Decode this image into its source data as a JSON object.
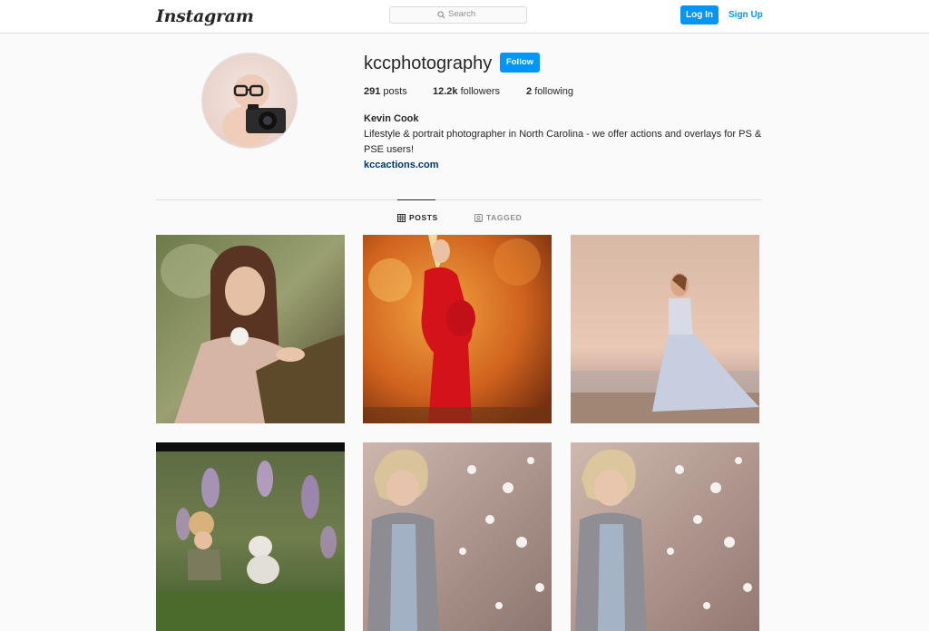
{
  "header": {
    "logo_text": "Instagram",
    "search_placeholder": "Search",
    "login_label": "Log In",
    "signup_label": "Sign Up"
  },
  "profile": {
    "username": "kccphotography",
    "follow_label": "Follow",
    "stats": {
      "posts_count": "291",
      "posts_label": "posts",
      "followers_count": "12.2k",
      "followers_label": "followers",
      "following_count": "2",
      "following_label": "following"
    },
    "full_name": "Kevin Cook",
    "bio": "Lifestyle & portrait photographer in North Carolina - we offer actions and overlays for PS & PSE users!",
    "website": "kccactions.com"
  },
  "tabs": [
    {
      "label": "POSTS",
      "icon": "grid-icon",
      "active": true
    },
    {
      "label": "TAGGED",
      "icon": "tag-icon",
      "active": false
    }
  ],
  "colors": {
    "accent": "#0095f6",
    "background": "#fafafa",
    "border": "#dbdbdb",
    "link": "#003569"
  },
  "posts": [
    {
      "subject": "girl-with-flower-in-woods"
    },
    {
      "subject": "pregnant-woman-red-dress-autumn"
    },
    {
      "subject": "woman-gown-on-beach"
    },
    {
      "subject": "child-with-puppy-wisteria"
    },
    {
      "subject": "boy-in-cotton-field"
    },
    {
      "subject": "boy-in-cotton-field"
    }
  ]
}
